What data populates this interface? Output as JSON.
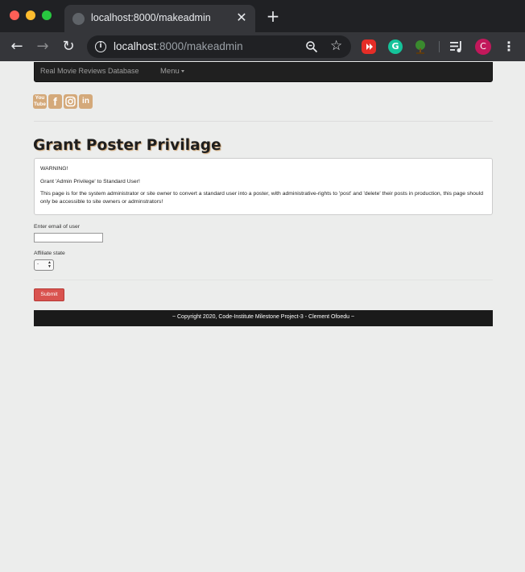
{
  "browser": {
    "tab_title": "localhost:8000/makeadmin",
    "url_host": "localhost",
    "url_rest": ":8000/makeadmin",
    "avatar_letter": "C",
    "icons": [
      "globe-icon",
      "close-icon",
      "new-tab-icon",
      "back-icon",
      "forward-icon",
      "reload-icon",
      "info-icon",
      "zoom-icon",
      "star-icon",
      "youtube-extension-icon",
      "grammarly-extension-icon",
      "tree-extension-icon",
      "media-control-icon",
      "menu-kebab-icon"
    ]
  },
  "navbar": {
    "brand": "Real Movie Reviews Database",
    "menu_label": "Menu"
  },
  "social": {
    "youtube": "You Tube",
    "facebook": "f",
    "linkedin": "in",
    "color": "#d4a97a"
  },
  "main": {
    "heading": "Grant Poster Privilage",
    "warning": {
      "title": "WARNING!",
      "line1": "Grant 'Admin Privilege' to Standard User!",
      "line2": "This page is for the system administrator or site owner to convert a standard user into a poster, with administrative-rights to 'post' and 'delete' their posts in production, this page should only be accessible to site owners or adminstrators!"
    },
    "form": {
      "email_label": "Enter email of user",
      "email_value": "",
      "affiliate_label": "Affiliate state",
      "affiliate_value": "-",
      "submit_label": "Submit"
    }
  },
  "footer": {
    "text": "~ Copyright 2020, Code-Institute Milestone Project-3 - Clement Ofoedu ~"
  },
  "colors": {
    "page_bg": "#ecedec",
    "navbar_bg": "#202020",
    "accent_tan": "#d4a97a",
    "submit_red": "#d9534f",
    "footer_bg": "#1a1a1a"
  }
}
